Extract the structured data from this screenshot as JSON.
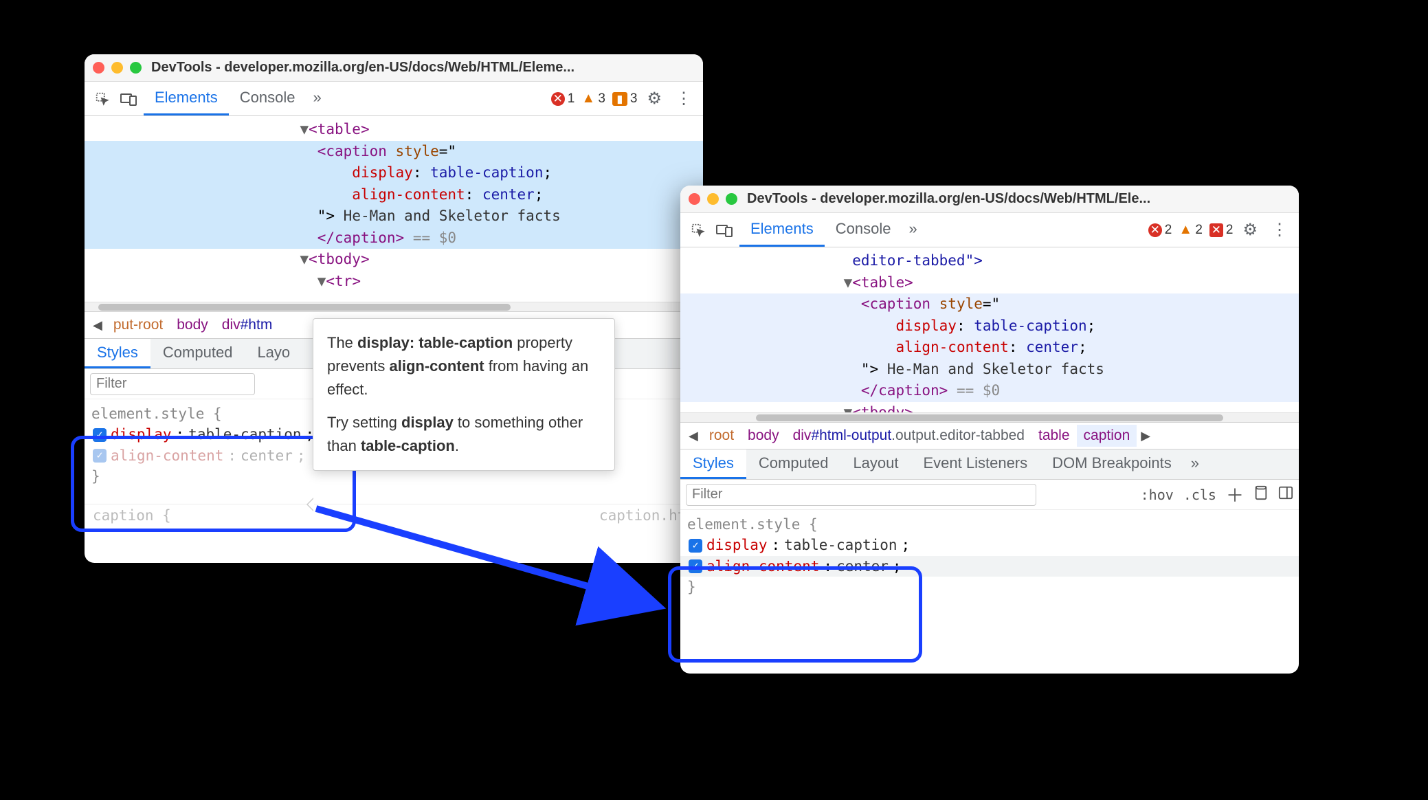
{
  "win1": {
    "title": "DevTools - developer.mozilla.org/en-US/docs/Web/HTML/Eleme...",
    "tabs": {
      "elements": "Elements",
      "console": "Console"
    },
    "alerts": {
      "errors": "1",
      "warnings": "3",
      "info": "3"
    },
    "dom": {
      "table_open": "<table>",
      "caption_open": "<caption",
      "style_attr": "style",
      "style_open": "=\"",
      "css_display_prop": "display",
      "css_display_val": "table-caption",
      "css_align_prop": "align-content",
      "css_align_val": "center",
      "style_close": "\">",
      "caption_text": " He-Man and Skeletor facts",
      "caption_close": "</caption>",
      "eq0": "== $0",
      "tbody_open": "<tbody>",
      "tr_open": "<tr>"
    },
    "breadcrumb": {
      "root": "put-root",
      "body": "body",
      "div": "div",
      "div_id": "#htm"
    },
    "subtabs": {
      "styles": "Styles",
      "computed": "Computed",
      "layout": "Layo"
    },
    "filter_placeholder": "Filter",
    "styles": {
      "selector": "element.style",
      "open": "{",
      "close": "}",
      "rows": [
        {
          "prop": "display",
          "val": "table-caption",
          "dim": false
        },
        {
          "prop": "align-content",
          "val": "center",
          "dim": true
        }
      ]
    },
    "faded": {
      "left": "caption {",
      "right": "caption.htm"
    }
  },
  "tooltip": {
    "l1a": "The ",
    "l1b": "display: table-caption",
    "l1c": " property prevents ",
    "l1d": "align-content",
    "l1e": " from having an effect.",
    "l2a": "Try setting ",
    "l2b": "display",
    "l2c": " to something other than ",
    "l2d": "table-caption",
    "l2e": "."
  },
  "win2": {
    "title": "DevTools - developer.mozilla.org/en-US/docs/Web/HTML/Ele...",
    "tabs": {
      "elements": "Elements",
      "console": "Console"
    },
    "alerts": {
      "errors": "2",
      "warnings": "2",
      "info": "2"
    },
    "dom": {
      "editor_tabbed": "editor-tabbed\">",
      "table_open": "<table>",
      "caption_open": "<caption",
      "style_attr": "style",
      "style_open": "=\"",
      "css_display_prop": "display",
      "css_display_val": "table-caption",
      "css_align_prop": "align-content",
      "css_align_val": "center",
      "style_close": "\">",
      "caption_text": " He-Man and Skeletor facts",
      "caption_close": "</caption>",
      "eq0": "== $0",
      "tbody_open": "<tbody>"
    },
    "breadcrumb": {
      "root": "root",
      "body": "body",
      "div_full": "div#html-output.output.editor-tabbed",
      "table": "table",
      "caption": "caption"
    },
    "subtabs": {
      "styles": "Styles",
      "computed": "Computed",
      "layout": "Layout",
      "event": "Event Listeners",
      "dom": "DOM Breakpoints"
    },
    "filter_placeholder": "Filter",
    "tools": {
      "hov": ":hov",
      "cls": ".cls"
    },
    "styles": {
      "selector": "element.style",
      "open": "{",
      "close": "}",
      "rows": [
        {
          "prop": "display",
          "val": "table-caption"
        },
        {
          "prop": "align-content",
          "val": "center"
        }
      ]
    }
  }
}
